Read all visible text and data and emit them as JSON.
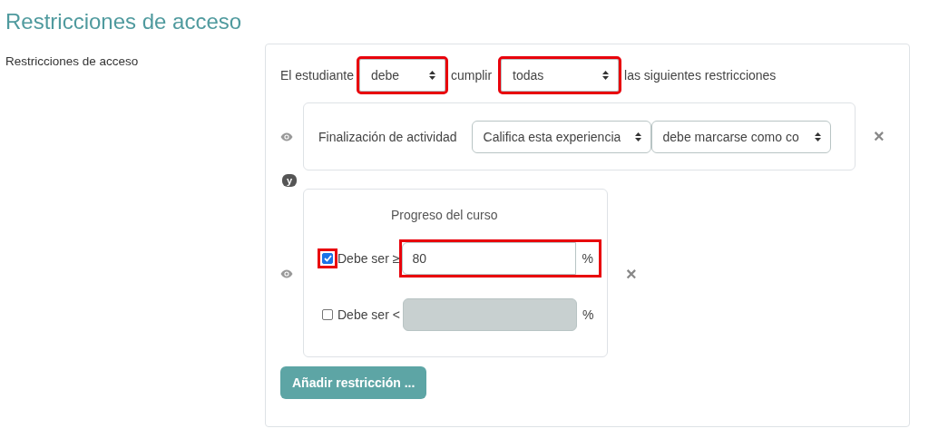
{
  "page_title": "Restricciones de acceso",
  "field_label": "Restricciones de acceso",
  "intro": {
    "prefix": "El estudiante",
    "select_1": {
      "value": "debe",
      "highlighted": true
    },
    "middle": "cumplir",
    "select_2": {
      "value": "todas",
      "highlighted": true
    },
    "suffix": "las siguientes restricciones"
  },
  "conditions": [
    {
      "kind": "activity",
      "label": "Finalización de actividad",
      "selects": [
        {
          "value": "Califica esta experiencia",
          "highlighted": false
        },
        {
          "value": "debe marcarse como co",
          "highlighted": false
        }
      ],
      "close": "×"
    },
    {
      "kind": "progress",
      "title": "Progreso del curso",
      "rows": [
        {
          "label": "Debe ser ≥",
          "checked": true,
          "checkbox_highlighted": true,
          "value": "80",
          "disabled": false,
          "field_highlighted": true,
          "unit": "%"
        },
        {
          "label": "Debe ser <",
          "checked": false,
          "checkbox_highlighted": false,
          "value": "",
          "disabled": true,
          "field_highlighted": false,
          "unit": "%"
        }
      ],
      "close": "×"
    }
  ],
  "connector": "y",
  "add_button": "Añadir restricción ..."
}
